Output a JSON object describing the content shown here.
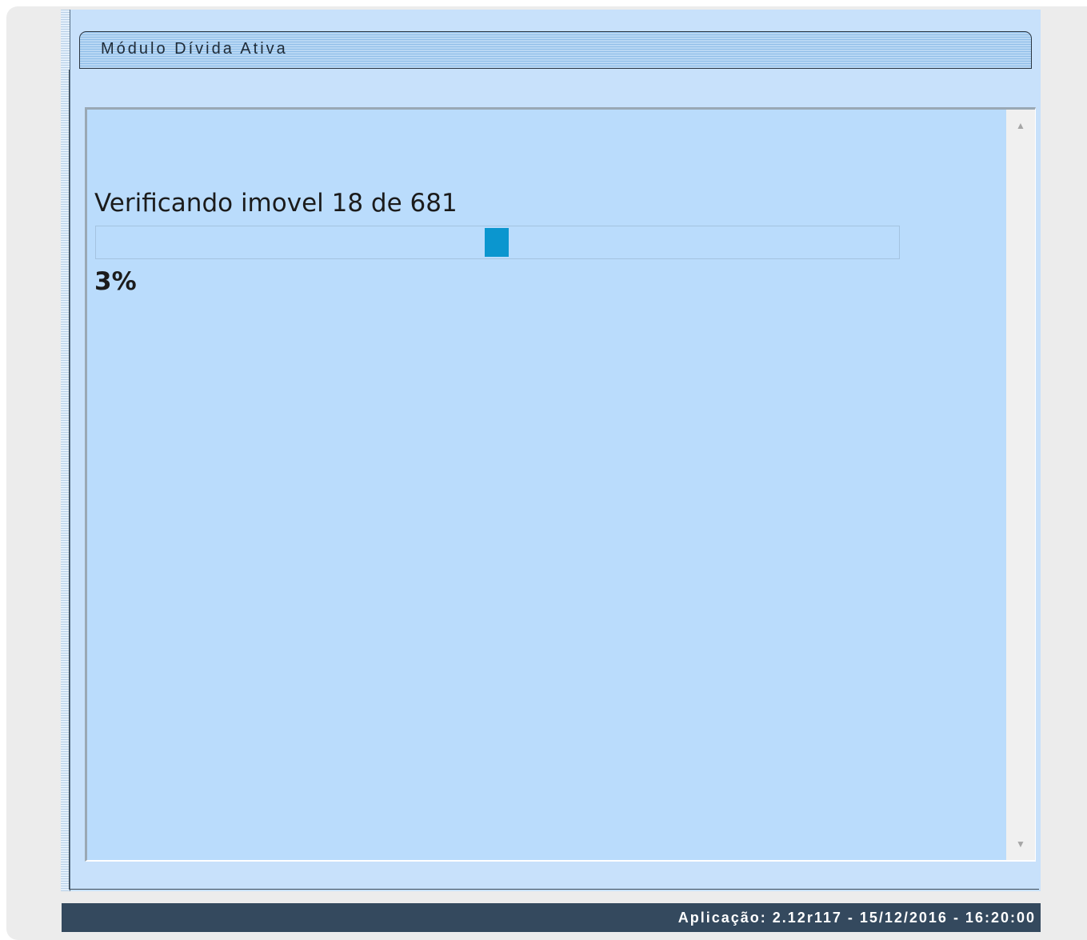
{
  "module": {
    "title": "Módulo Dívida Ativa"
  },
  "progress": {
    "status_text": "Verificando imovel 18 de 681",
    "current": 18,
    "total": 681,
    "percent_label": "3%",
    "percent_value": 3
  },
  "footer": {
    "app_info": "Aplicação: 2.12r117 - 15/12/2016 - 16:20:00"
  },
  "scrollbar": {
    "up_icon": "arrow-up-icon",
    "down_icon": "arrow-down-icon"
  },
  "colors": {
    "panel_bg": "#c8e1fb",
    "content_bg": "#badcfc",
    "progress_marker": "#0b96cf",
    "footer_bg": "#34495e"
  }
}
